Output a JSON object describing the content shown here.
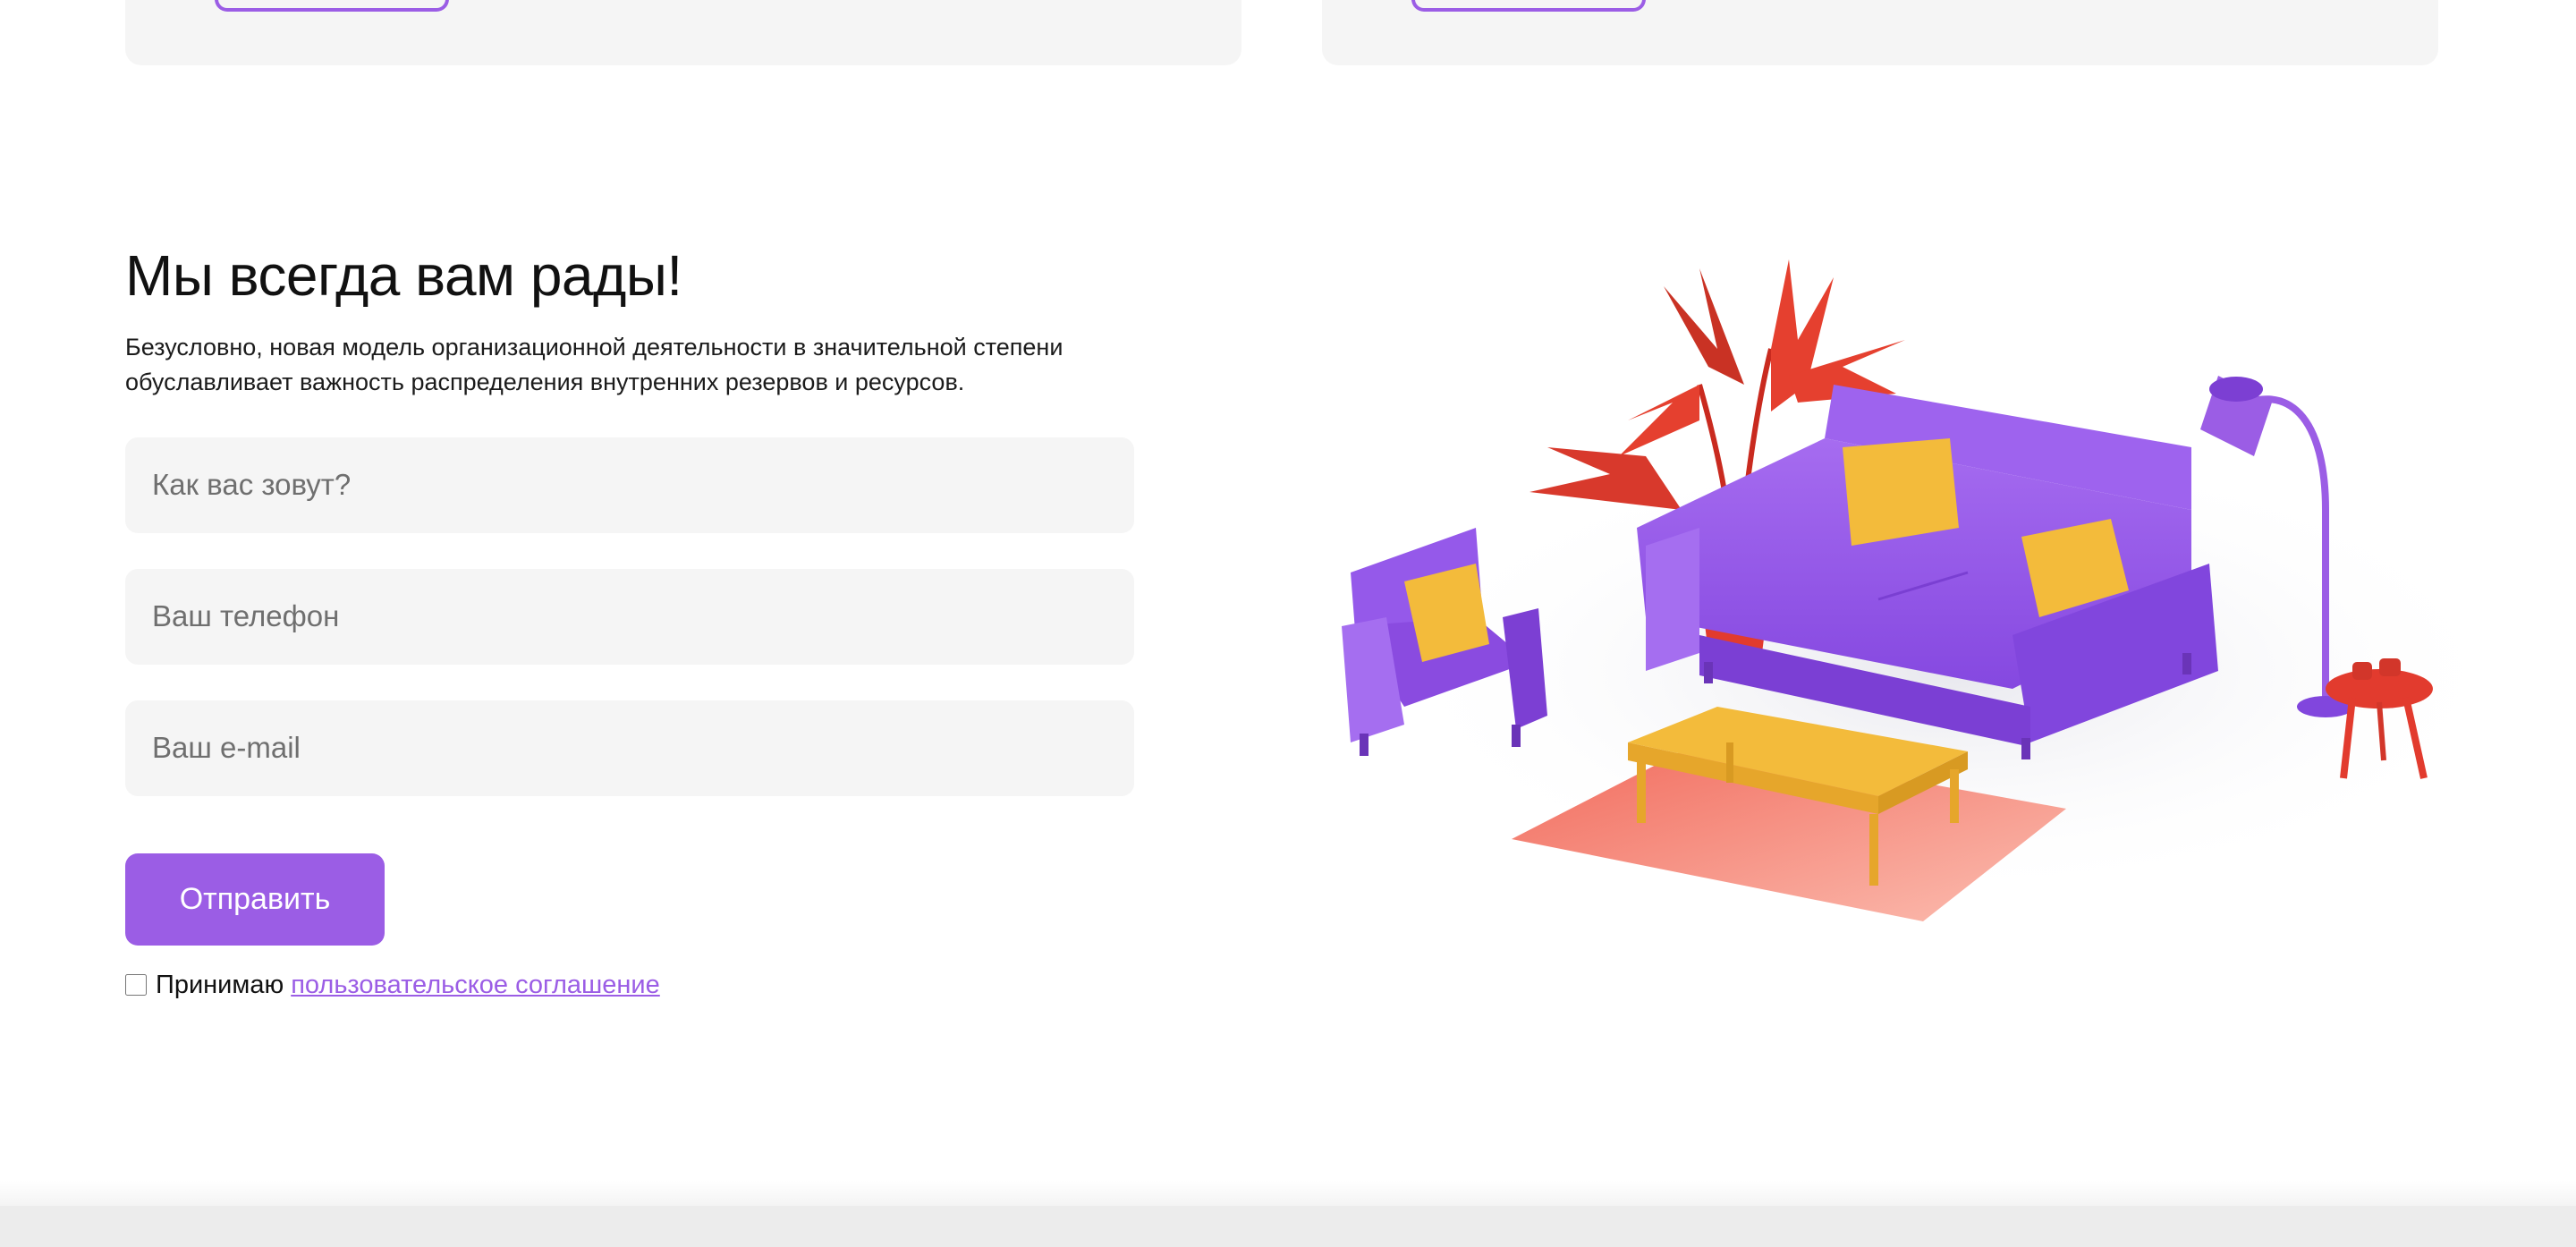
{
  "contact": {
    "title": "Мы всегда вам рады!",
    "description_line1": "Безусловно, новая модель организационной деятельности в значительной степени",
    "description_line2": "обуславливает важность распределения внутренних резервов и ресурсов.",
    "name_placeholder": "Как вас зовут?",
    "phone_placeholder": "Ваш телефон",
    "email_placeholder": "Ваш e-mail",
    "submit_label": "Отправить",
    "consent_text": "Принимаю",
    "consent_link": "пользовательское соглашение"
  },
  "colors": {
    "accent": "#9b5de5",
    "field_bg": "#f5f5f5"
  }
}
